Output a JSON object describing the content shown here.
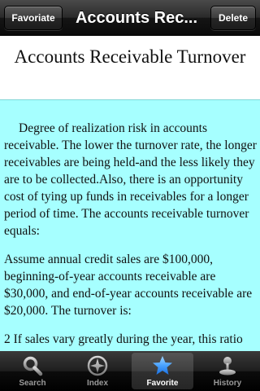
{
  "nav": {
    "left_button": "Favoriate",
    "title": "Accounts Rec...",
    "right_button": "Delete"
  },
  "article": {
    "heading": "Accounts Receivable Turnover",
    "paragraphs": [
      "Degree of realization risk in accounts receivable. The lower the turnover rate, the longer receivables are being held-and the less likely they are to be collected.Also, there is an opportunity cost of tying up funds in receivables for a longer period of time. The accounts receivable turnover equals:",
      "Assume annual credit sales are $100,000, beginning-of-year accounts receivable are $30,000, and end-of-year accounts receivable are $20,000. The turnover is:",
      "2 If sales vary greatly during the year, this ratio"
    ]
  },
  "tabs": [
    {
      "label": "Search",
      "icon": "magnifier-icon"
    },
    {
      "label": "Index",
      "icon": "compass-icon"
    },
    {
      "label": "Favorite",
      "icon": "star-icon",
      "selected": true
    },
    {
      "label": "History",
      "icon": "joystick-icon"
    }
  ],
  "colors": {
    "body_background": "#a6ffff",
    "header_background": "#ffffff",
    "selected_star": "#4aa3ff"
  }
}
